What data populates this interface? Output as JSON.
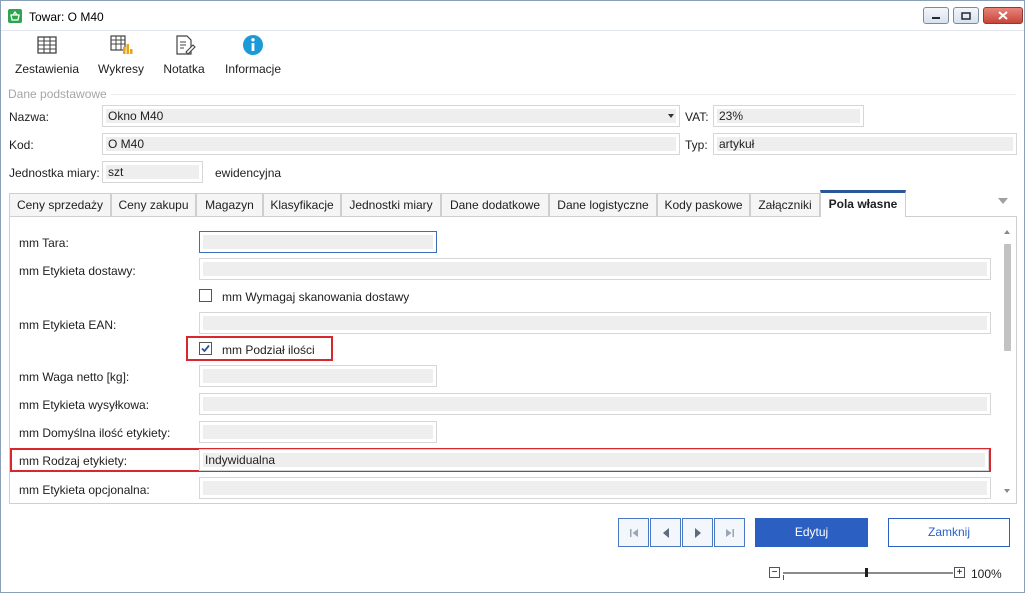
{
  "window": {
    "title": "Towar: O M40"
  },
  "toolbar": {
    "items": [
      {
        "label": "Zestawienia",
        "icon": "table-icon"
      },
      {
        "label": "Wykresy",
        "icon": "chart-table-icon"
      },
      {
        "label": "Notatka",
        "icon": "note-edit-icon"
      },
      {
        "label": "Informacje",
        "icon": "info-icon"
      }
    ]
  },
  "basic": {
    "group_label": "Dane podstawowe",
    "nazwa_label": "Nazwa:",
    "nazwa_value": "Okno M40",
    "vat_label": "VAT:",
    "vat_value": "23%",
    "kod_label": "Kod:",
    "kod_value": "O M40",
    "typ_label": "Typ:",
    "typ_value": "artykuł",
    "jm_label": "Jednostka miary:",
    "jm_value": "szt",
    "jm_note": "ewidencyjna"
  },
  "tabs": [
    {
      "label": "Ceny sprzedaży"
    },
    {
      "label": "Ceny zakupu"
    },
    {
      "label": "Magazyn"
    },
    {
      "label": "Klasyfikacje"
    },
    {
      "label": "Jednostki miary"
    },
    {
      "label": "Dane dodatkowe"
    },
    {
      "label": "Dane logistyczne"
    },
    {
      "label": "Kody paskowe"
    },
    {
      "label": "Załączniki"
    },
    {
      "label": "Pola własne"
    }
  ],
  "active_tab": "Pola własne",
  "custom_fields": {
    "tara_label": "mm Tara:",
    "tara_value": "",
    "etykieta_dostawy_label": "mm Etykieta dostawy:",
    "etykieta_dostawy_value": "",
    "wymagaj_label": "mm Wymagaj skanowania dostawy",
    "wymagaj_checked": false,
    "etykieta_ean_label": "mm Etykieta EAN:",
    "etykieta_ean_value": "",
    "podzial_label": "mm Podział ilości",
    "podzial_checked": true,
    "waga_label": "mm Waga netto [kg]:",
    "waga_value": "",
    "wysylkowa_label": "mm Etykieta wysyłkowa:",
    "wysylkowa_value": "",
    "domyslna_label": "mm Domyślna ilość etykiety:",
    "domyslna_value": "",
    "rodzaj_label": "mm Rodzaj etykiety:",
    "rodzaj_value": "Indywidualna",
    "opcjonalna_label": "mm Etykieta opcjonalna:",
    "opcjonalna_value": ""
  },
  "actions": {
    "edit_label": "Edytuj",
    "close_label": "Zamknij"
  },
  "zoom": {
    "minus": "−",
    "plus": "+",
    "value": "100%"
  },
  "colors": {
    "accent": "#2b5fc2",
    "highlight": "#d9272e",
    "tab_active": "#2b579a"
  }
}
